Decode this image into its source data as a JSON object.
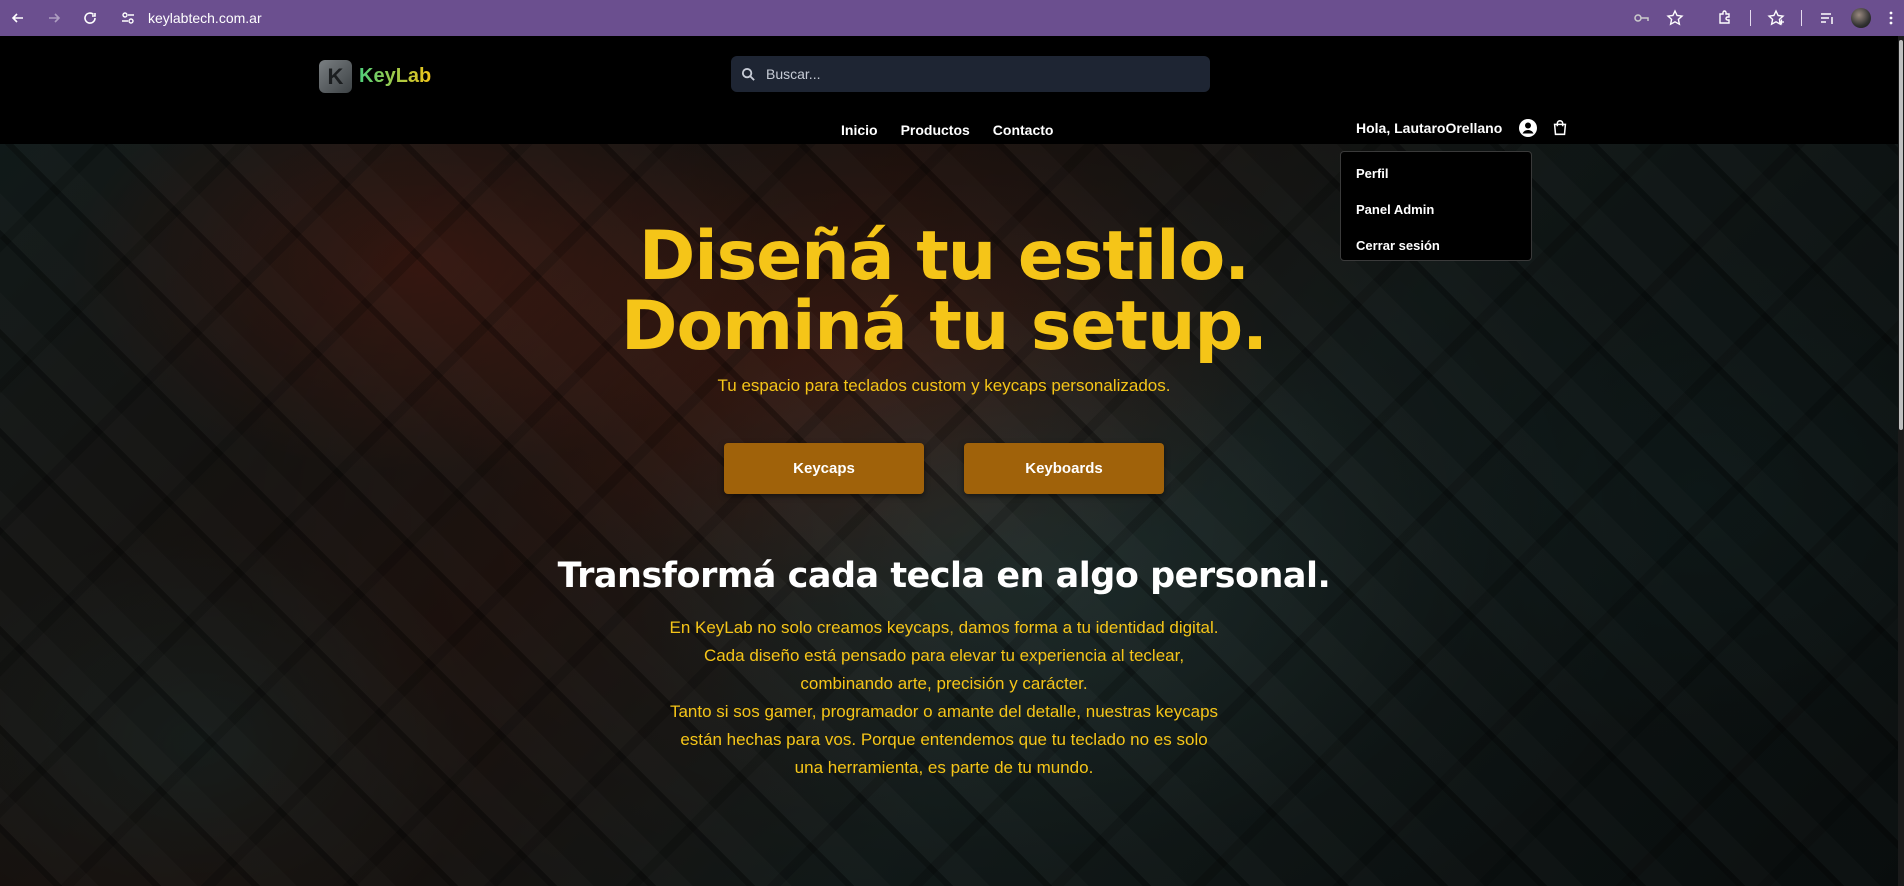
{
  "browser": {
    "url": "keylabtech.com.ar"
  },
  "header": {
    "logo_letter": "K",
    "logo_text": "KeyLab",
    "search_placeholder": "Buscar...",
    "nav": [
      "Inicio",
      "Productos",
      "Contacto"
    ],
    "greeting": "Hola, LautaroOrellano"
  },
  "user_menu": {
    "items": [
      "Perfil",
      "Panel Admin",
      "Cerrar sesión"
    ]
  },
  "hero": {
    "title_line1": "Diseñá tu estilo.",
    "title_line2": "Dominá tu setup.",
    "tagline": "Tu espacio para teclados custom y keycaps personalizados.",
    "buttons": [
      "Keycaps",
      "Keyboards"
    ],
    "subtitle": "Transformá cada tecla en algo personal.",
    "paragraph_lines": [
      "En KeyLab no solo creamos keycaps, damos forma a tu identidad digital.",
      "Cada diseño está pensado para elevar tu experiencia al teclear,",
      "combinando arte, precisión y carácter.",
      "Tanto si sos gamer, programador o amante del detalle, nuestras keycaps",
      "están hechas para vos. Porque entendemos que tu teclado no es solo",
      "una herramienta, es parte de tu mundo."
    ]
  },
  "colors": {
    "accent_yellow": "#f5c518",
    "button_brown": "#a0620a",
    "browser_purple": "#6b4f8f"
  }
}
